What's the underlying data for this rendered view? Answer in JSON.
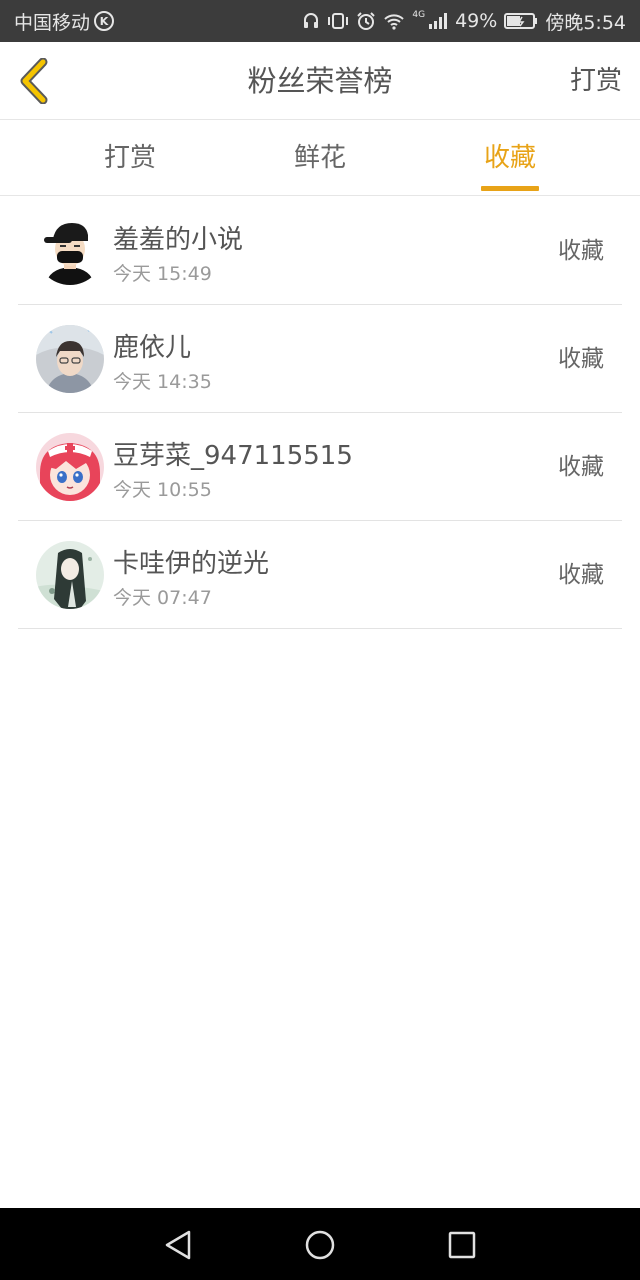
{
  "status_bar": {
    "carrier": "中国移动",
    "carrier_badge": "K",
    "network_badge": "4G",
    "battery": "49%",
    "time": "傍晚5:54",
    "icons": [
      "headphones-icon",
      "vibrate-icon",
      "alarm-icon",
      "wifi-icon",
      "signal-icon",
      "battery-icon"
    ]
  },
  "header": {
    "title": "粉丝荣誉榜",
    "right_action": "打赏",
    "back_icon": "chevron-left-icon",
    "back_icon_color": "#f5c400"
  },
  "tabs": [
    {
      "label": "打赏",
      "active": false
    },
    {
      "label": "鲜花",
      "active": false
    },
    {
      "label": "收藏",
      "active": true
    }
  ],
  "accent_color": "#e8a317",
  "list": [
    {
      "name": "羞羞的小说",
      "time": "今天 15:49",
      "action": "收藏",
      "avatar": "masked-man-avatar"
    },
    {
      "name": "鹿依儿",
      "time": "今天 14:35",
      "action": "收藏",
      "avatar": "girl-photo-avatar"
    },
    {
      "name": "豆芽菜_947115515",
      "time": "今天 10:55",
      "action": "收藏",
      "avatar": "anime-nurse-avatar"
    },
    {
      "name": "卡哇伊的逆光",
      "time": "今天 07:47",
      "action": "收藏",
      "avatar": "anime-girl-avatar"
    }
  ],
  "nav_bar": {
    "icons": [
      "back-triangle-icon",
      "home-circle-icon",
      "recents-square-icon"
    ]
  }
}
